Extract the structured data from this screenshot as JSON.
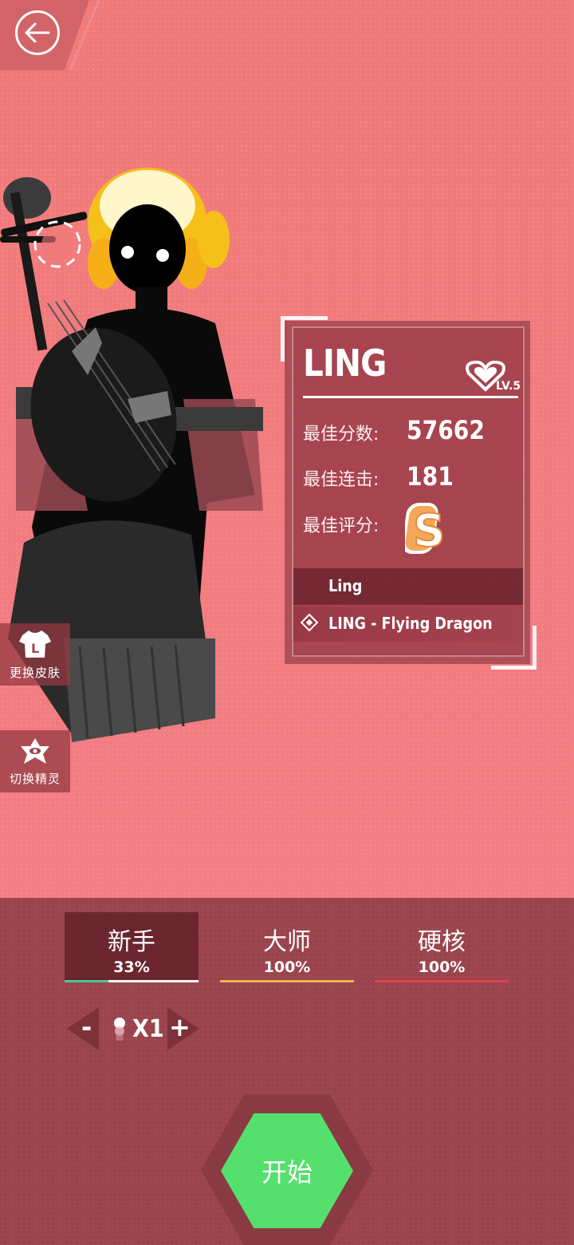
{
  "header": {
    "back_icon": "back-arrow-icon"
  },
  "side_buttons": [
    {
      "label": "更换皮肤",
      "icon": "shirt-icon"
    },
    {
      "label": "切换精灵",
      "icon": "elf-icon"
    }
  ],
  "character": {
    "name": "LING",
    "level": "LV.5",
    "stats": {
      "best_score_label": "最佳分数:",
      "best_score": "57662",
      "best_combo_label": "最佳连击:",
      "best_combo": "181",
      "best_grade_label": "最佳评分:",
      "best_grade": "S"
    },
    "song_group": "Ling",
    "song": "LING - Flying Dragon"
  },
  "difficulties": [
    {
      "name": "新手",
      "percent": "33%",
      "color": "#49c98a",
      "progress": 0.33,
      "active": true
    },
    {
      "name": "大师",
      "percent": "100%",
      "color": "#e6b84a",
      "progress": 1.0,
      "active": false
    },
    {
      "name": "硬核",
      "percent": "100%",
      "color": "#e0404e",
      "progress": 1.0,
      "active": false
    }
  ],
  "multiplier": {
    "minus": "-",
    "value": "X1",
    "plus": "+"
  },
  "start_button": {
    "label": "开始",
    "color": "#55e06e"
  }
}
